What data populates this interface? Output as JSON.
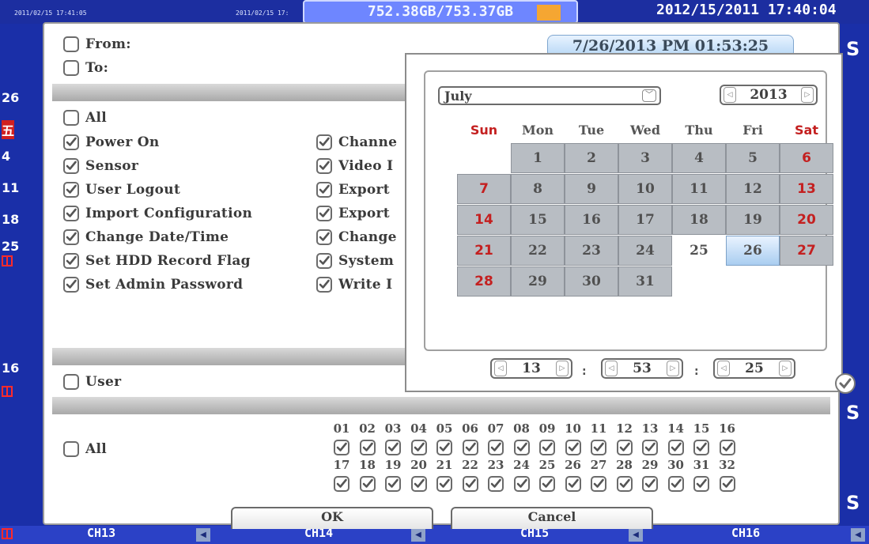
{
  "background": {
    "hdd_usage": "752.38GB/753.37GB",
    "hdd_fill_fraction": 0.999,
    "clock": "2012/15/2011 17:40:04",
    "top_timestamps": [
      "2011/02/15 17:41:05",
      "2011/02/15 17:"
    ],
    "day_numbers": [
      "26",
      "五",
      "4",
      "11",
      "18",
      "25",
      "16"
    ],
    "s_glyph": "S",
    "channels": [
      "CH13",
      "CH14",
      "CH15",
      "CH16"
    ]
  },
  "dialog": {
    "from_label": "From:",
    "to_label": "To:",
    "datetime_value": "7/26/2013 PM 01:53:25",
    "all_label": "All",
    "events_left": [
      "Power On",
      "Sensor",
      "User Logout",
      "Import Configuration",
      "Change Date/Time",
      "Set HDD Record Flag",
      "Set Admin Password"
    ],
    "events_right": [
      "Channe",
      "Video I",
      "Export",
      "Export",
      "Change",
      "System",
      "Write I"
    ],
    "user_label": "User",
    "channel_all_label": "All",
    "channel_numbers_row1": [
      "01",
      "02",
      "03",
      "04",
      "05",
      "06",
      "07",
      "08",
      "09",
      "10",
      "11",
      "12",
      "13",
      "14",
      "15",
      "16"
    ],
    "channel_numbers_row2": [
      "17",
      "18",
      "19",
      "20",
      "21",
      "22",
      "23",
      "24",
      "25",
      "26",
      "27",
      "28",
      "29",
      "30",
      "31",
      "32"
    ],
    "ok_label": "OK",
    "cancel_label": "Cancel"
  },
  "calendar": {
    "month": "July",
    "year": "2013",
    "weekdays": [
      "Sun",
      "Mon",
      "Tue",
      "Wed",
      "Thu",
      "Fri",
      "Sat"
    ],
    "weeks": [
      [
        "",
        "1",
        "2",
        "3",
        "4",
        "5",
        "6"
      ],
      [
        "7",
        "8",
        "9",
        "10",
        "11",
        "12",
        "13"
      ],
      [
        "14",
        "15",
        "16",
        "17",
        "18",
        "19",
        "20"
      ],
      [
        "21",
        "22",
        "23",
        "24",
        "25",
        "26",
        "27"
      ],
      [
        "28",
        "29",
        "30",
        "31",
        "",
        "",
        ""
      ]
    ],
    "selected_day": "26",
    "hour": "13",
    "minute": "53",
    "second": "25",
    "time_separator": ":"
  }
}
